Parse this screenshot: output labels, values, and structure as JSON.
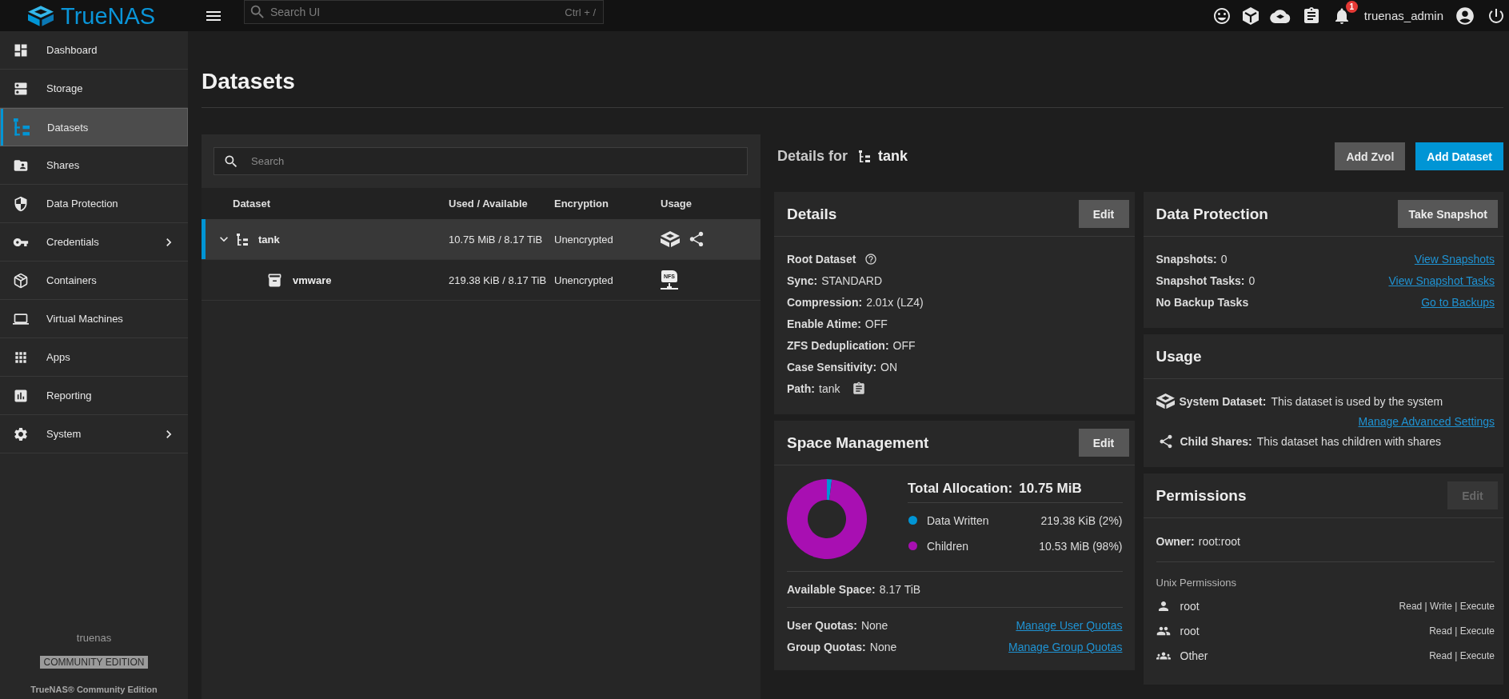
{
  "topbar": {
    "brand": "TrueNAS",
    "search": {
      "placeholder": "Search UI",
      "shortcut": "Ctrl + /"
    },
    "notification_count": "1",
    "username": "truenas_admin"
  },
  "sidebar": {
    "items": [
      {
        "label": "Dashboard",
        "selected": false,
        "has_submenu": false
      },
      {
        "label": "Storage",
        "selected": false,
        "has_submenu": false
      },
      {
        "label": "Datasets",
        "selected": true,
        "has_submenu": false
      },
      {
        "label": "Shares",
        "selected": false,
        "has_submenu": false
      },
      {
        "label": "Data Protection",
        "selected": false,
        "has_submenu": false
      },
      {
        "label": "Credentials",
        "selected": false,
        "has_submenu": true
      },
      {
        "label": "Containers",
        "selected": false,
        "has_submenu": false
      },
      {
        "label": "Virtual Machines",
        "selected": false,
        "has_submenu": false
      },
      {
        "label": "Apps",
        "selected": false,
        "has_submenu": false
      },
      {
        "label": "Reporting",
        "selected": false,
        "has_submenu": false
      },
      {
        "label": "System",
        "selected": false,
        "has_submenu": true
      }
    ],
    "hostname": "truenas",
    "edition_badge": "COMMUNITY EDITION",
    "footer": "TrueNAS® Community Edition"
  },
  "page": {
    "title": "Datasets"
  },
  "dataset_tree": {
    "search": {
      "placeholder": "Search"
    },
    "columns": [
      "Dataset",
      "Used / Available",
      "Encryption",
      "Usage"
    ],
    "rows": [
      {
        "kind": "root",
        "name": "tank",
        "used_available": "10.75 MiB / 8.17 TiB",
        "encryption": "Unencrypted",
        "usage": [
          {
            "kind": "system"
          },
          {
            "kind": "share"
          }
        ],
        "selected": true,
        "expanded": true,
        "children": [
          {
            "kind": "dataset",
            "name": "vmware",
            "used_available": "219.38 KiB / 8.17 TiB",
            "encryption": "Unencrypted",
            "usage": [
              {
                "kind": "nfs",
                "label": "NFS"
              }
            ],
            "selected": false
          }
        ]
      }
    ]
  },
  "details_header": {
    "heading": "Details for",
    "dataset": "tank",
    "buttons": [
      {
        "label": "Add Zvol",
        "kind": "secondary"
      },
      {
        "label": "Add Dataset",
        "kind": "primary"
      }
    ]
  },
  "details": {
    "title": "Details",
    "edit": {
      "label": "Edit",
      "disabled": false
    },
    "items": [
      {
        "kind": "flag",
        "label": "Root Dataset"
      },
      {
        "kind": "field",
        "label": "Sync:",
        "value": "STANDARD"
      },
      {
        "kind": "field",
        "label": "Compression:",
        "value": "2.01x (LZ4)"
      },
      {
        "kind": "field",
        "label": "Enable Atime:",
        "value": "OFF"
      },
      {
        "kind": "field",
        "label": "ZFS Deduplication:",
        "value": "OFF"
      },
      {
        "kind": "field",
        "label": "Case Sensitivity:",
        "value": "ON"
      },
      {
        "kind": "path",
        "label": "Path:",
        "value": "tank"
      }
    ]
  },
  "space_management": {
    "title": "Space Management",
    "edit": {
      "label": "Edit",
      "disabled": false
    },
    "chart_data": {
      "type": "donut",
      "values": [
        2,
        98
      ]
    },
    "total": {
      "label": "Total Allocation:",
      "value": "10.75 MiB"
    },
    "legend": [
      {
        "label": "Data Written",
        "value": "219.38 KiB (2%)",
        "color": "#0095d5"
      },
      {
        "label": "Children",
        "value": "10.53 MiB (98%)",
        "color": "#a80fb2"
      }
    ],
    "available": {
      "label": "Available Space:",
      "value": "8.17 TiB"
    },
    "quotas": [
      {
        "label": "User Quotas:",
        "value": "None",
        "link": "Manage User Quotas"
      },
      {
        "label": "Group Quotas:",
        "value": "None",
        "link": "Manage Group Quotas"
      }
    ]
  },
  "data_protection": {
    "title": "Data Protection",
    "button": "Take Snapshot",
    "rows": [
      {
        "label": "Snapshots:",
        "value": "0",
        "link": "View Snapshots"
      },
      {
        "label": "Snapshot Tasks:",
        "value": "0",
        "link": "View Snapshot Tasks"
      },
      {
        "label": "No Backup Tasks",
        "link": "Go to Backups"
      }
    ]
  },
  "usage": {
    "title": "Usage",
    "rows": [
      {
        "kind": "system",
        "label": "System Dataset:",
        "text": "This dataset is used by the system",
        "link": "Manage Advanced Settings"
      },
      {
        "kind": "share",
        "label": "Child Shares:",
        "text": "This dataset has children with shares"
      }
    ]
  },
  "permissions": {
    "title": "Permissions",
    "edit": {
      "label": "Edit",
      "disabled": true
    },
    "owner": {
      "label": "Owner:",
      "value": "root:root"
    },
    "subtitle": "Unix Permissions",
    "entries": [
      {
        "kind": "user",
        "name": "root",
        "access": "Read | Write | Execute"
      },
      {
        "kind": "group",
        "name": "root",
        "access": "Read | Execute"
      },
      {
        "kind": "other",
        "name": "Other",
        "access": "Read | Execute"
      }
    ]
  }
}
